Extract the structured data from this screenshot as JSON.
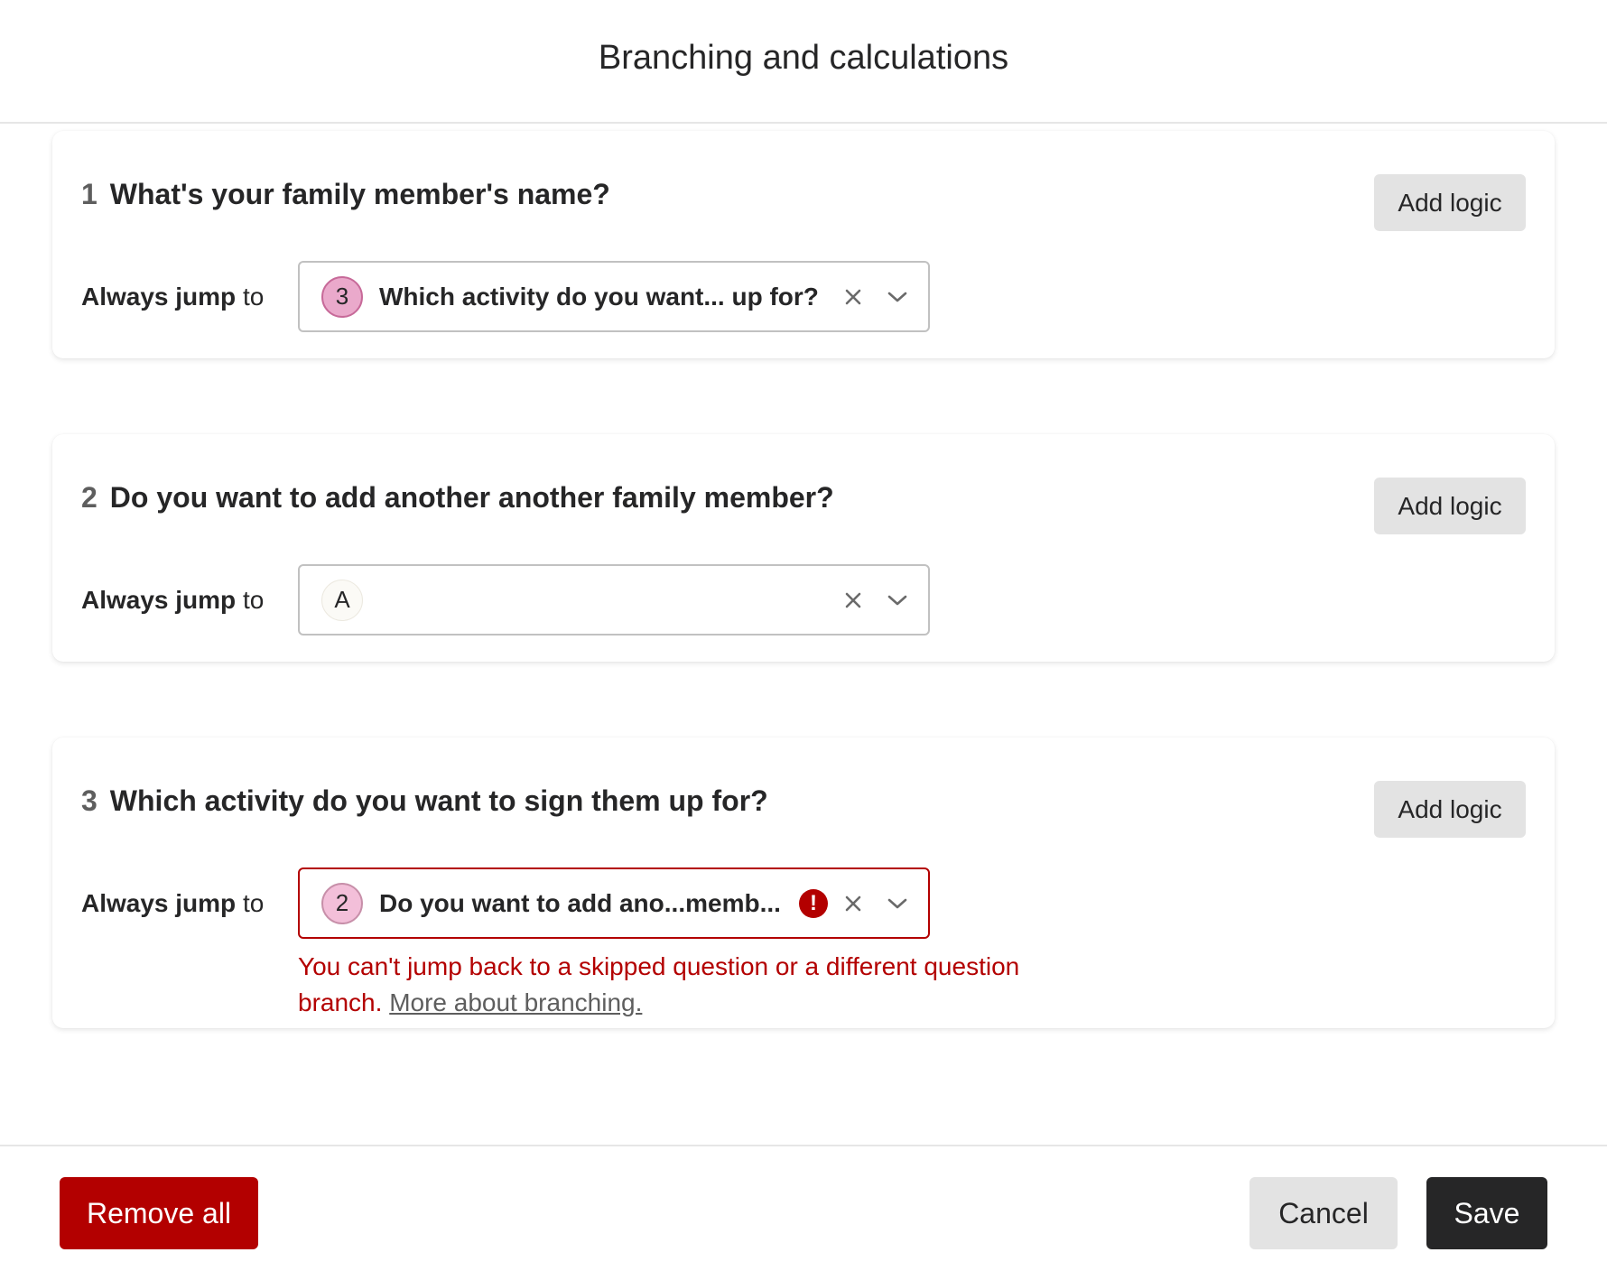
{
  "dialog": {
    "title": "Branching and calculations"
  },
  "questions": [
    {
      "number": "1",
      "title": "What's your family member's name?",
      "add_logic_label": "Add logic",
      "jump_label_bold": "Always jump",
      "jump_label_rest": " to",
      "target": {
        "badge": "3",
        "text": "Which activity do you want... up for?",
        "has_error": false
      }
    },
    {
      "number": "2",
      "title": "Do you want to add another another family member?",
      "add_logic_label": "Add logic",
      "jump_label_bold": "Always jump",
      "jump_label_rest": " to",
      "target": {
        "badge": "A",
        "text": "",
        "has_error": false
      }
    },
    {
      "number": "3",
      "title": "Which activity do you want to sign them up for?",
      "add_logic_label": "Add logic",
      "jump_label_bold": "Always jump",
      "jump_label_rest": " to",
      "target": {
        "badge": "2",
        "text": "Do you want to add ano...memb...",
        "has_error": true,
        "error_icon_glyph": "!"
      },
      "error_message": "You can't jump back to a skipped question or a different question branch.",
      "error_link": "More about branching."
    }
  ],
  "footer": {
    "remove_all_label": "Remove all",
    "cancel_label": "Cancel",
    "save_label": "Save"
  },
  "colors": {
    "error": "#b30000",
    "primary_dark": "#262627",
    "secondary_button": "#e3e3e3",
    "badge_pink": "#eaa9cb"
  }
}
